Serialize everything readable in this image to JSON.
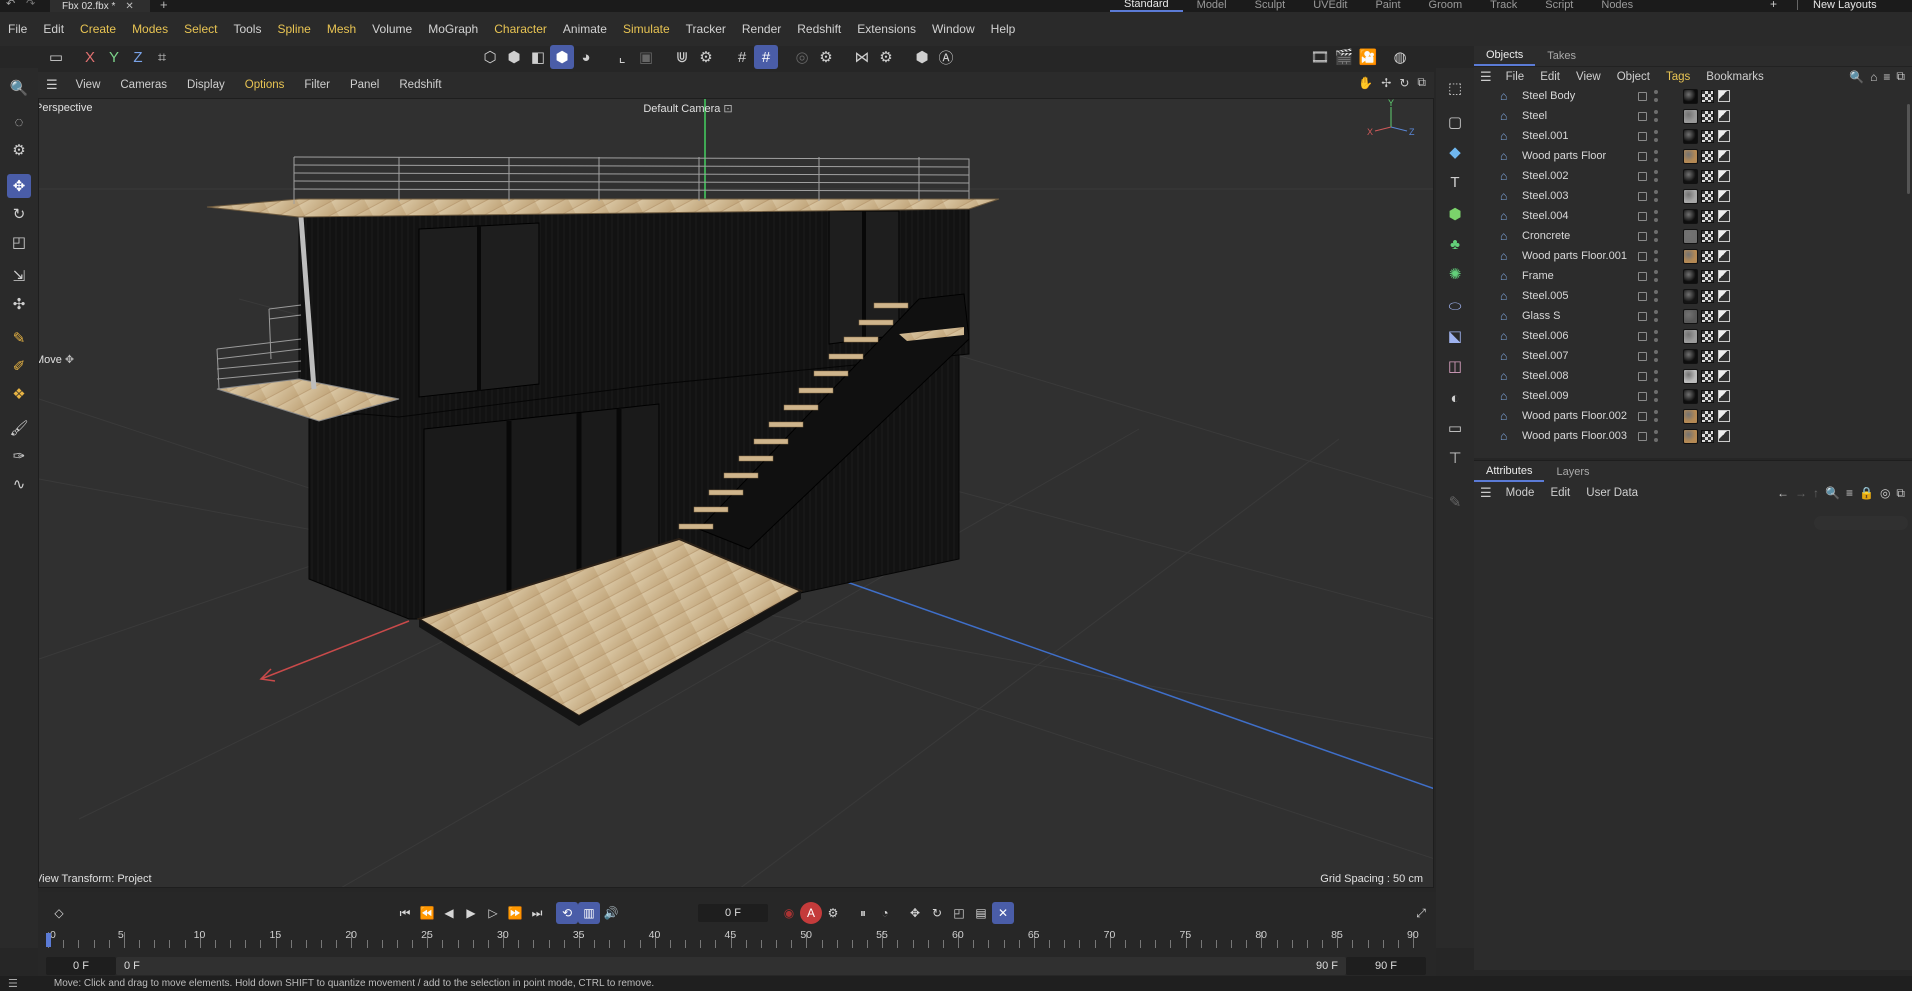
{
  "titlebar": {
    "tab": "Fbx 02.fbx *"
  },
  "layouts": [
    "Standard",
    "Model",
    "Sculpt",
    "UVEdit",
    "Paint",
    "Groom",
    "Track",
    "Script",
    "Nodes"
  ],
  "new_layouts": "New Layouts",
  "menu": [
    {
      "t": "File"
    },
    {
      "t": "Edit"
    },
    {
      "t": "Create",
      "y": true
    },
    {
      "t": "Modes",
      "y": true
    },
    {
      "t": "Select",
      "y": true
    },
    {
      "t": "Tools"
    },
    {
      "t": "Spline",
      "y": true
    },
    {
      "t": "Mesh",
      "y": true
    },
    {
      "t": "Volume"
    },
    {
      "t": "MoGraph"
    },
    {
      "t": "Character",
      "y": true
    },
    {
      "t": "Animate"
    },
    {
      "t": "Simulate",
      "y": true
    },
    {
      "t": "Tracker"
    },
    {
      "t": "Render"
    },
    {
      "t": "Redshift"
    },
    {
      "t": "Extensions"
    },
    {
      "t": "Window"
    },
    {
      "t": "Help"
    }
  ],
  "viewport_menu": [
    {
      "t": "View"
    },
    {
      "t": "Cameras"
    },
    {
      "t": "Display"
    },
    {
      "t": "Options",
      "y": true
    },
    {
      "t": "Filter"
    },
    {
      "t": "Panel"
    },
    {
      "t": "Redshift"
    }
  ],
  "axes": {
    "x": "X",
    "y": "Y",
    "z": "Z"
  },
  "viewport": {
    "label": "Perspective",
    "camera": "Default Camera",
    "tool": "Move",
    "view_transform": "View Transform: Project",
    "grid_spacing": "Grid Spacing : 50 cm"
  },
  "objects_tabs": [
    "Objects",
    "Takes"
  ],
  "objects_menu": [
    "File",
    "Edit",
    "View",
    "Object",
    "Tags",
    "Bookmarks"
  ],
  "objects": [
    {
      "name": "Steel Body",
      "mat": "#0c0c0c"
    },
    {
      "name": "Steel",
      "mat": "#9a9a9a"
    },
    {
      "name": "Steel.001",
      "mat": "#0e0e0e"
    },
    {
      "name": "Wood parts Floor",
      "mat": "#b58a55"
    },
    {
      "name": "Steel.002",
      "mat": "#111111"
    },
    {
      "name": "Steel.003",
      "mat": "#a8a8a8"
    },
    {
      "name": "Steel.004",
      "mat": "#0e0e0e"
    },
    {
      "name": "Croncrete",
      "mat": "#6f6f6f"
    },
    {
      "name": "Wood parts Floor.001",
      "mat": "#b58a55"
    },
    {
      "name": "Frame",
      "mat": "#0e0e0e"
    },
    {
      "name": "Steel.005",
      "mat": "#141414"
    },
    {
      "name": "Glass S",
      "mat": "#5a5a5a"
    },
    {
      "name": "Steel.006",
      "mat": "#9c9c9c"
    },
    {
      "name": "Steel.007",
      "mat": "#0e0e0e"
    },
    {
      "name": "Steel.008",
      "mat": "#bcbcbc"
    },
    {
      "name": "Steel.009",
      "mat": "#0e0e0e"
    },
    {
      "name": "Wood parts Floor.002",
      "mat": "#b58a55"
    },
    {
      "name": "Wood parts Floor.003",
      "mat": "#b58a55"
    }
  ],
  "attr_tabs": [
    "Attributes",
    "Layers"
  ],
  "attr_menu": [
    "Mode",
    "Edit",
    "User Data"
  ],
  "timeline": {
    "frame": "0 F",
    "start": "0 F",
    "start2": "0 F",
    "end": "90 F",
    "end2": "90 F",
    "ticks": [
      "0",
      "5",
      "10",
      "15",
      "20",
      "25",
      "30",
      "35",
      "40",
      "45",
      "50",
      "55",
      "60",
      "65",
      "70",
      "75",
      "80",
      "85",
      "90"
    ]
  },
  "status": "Move: Click and drag to move elements. Hold down SHIFT to quantize movement / add to the selection in point mode, CTRL to remove.",
  "colors": {
    "accent": "#4a5da8",
    "highlight": "#e8c453",
    "axis_x": "#c94a4a",
    "axis_y": "#4cc46a",
    "axis_z": "#3f6fc9"
  }
}
